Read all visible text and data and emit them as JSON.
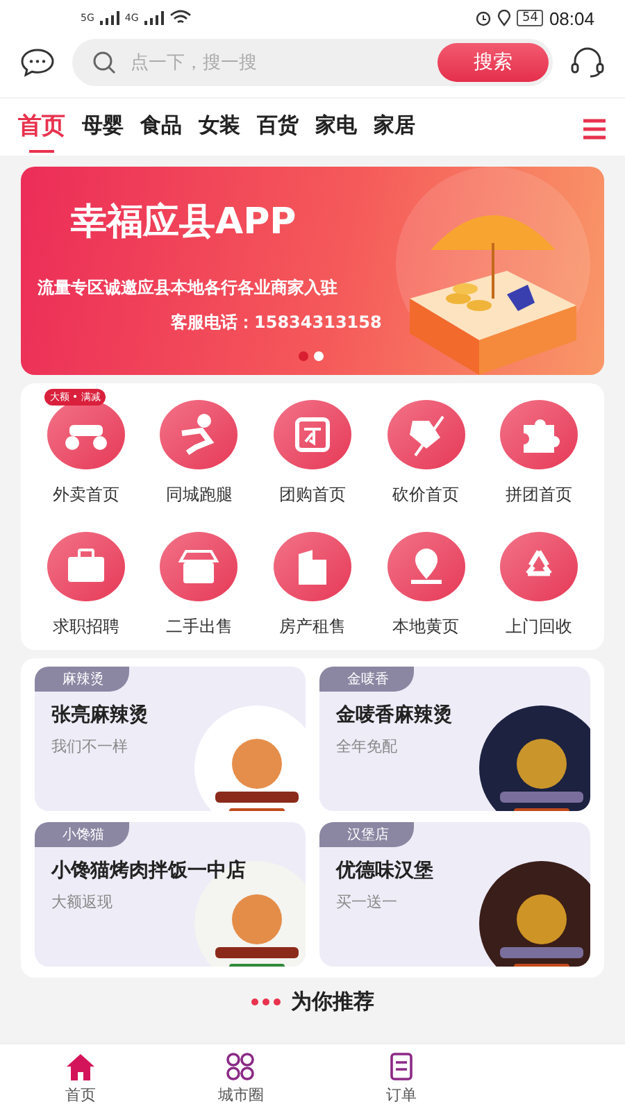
{
  "status_bar": {
    "network_1": "5G",
    "network_2": "4G",
    "battery": "54",
    "time": "08:04"
  },
  "search": {
    "placeholder": "点一下，搜一搜",
    "button": "搜索"
  },
  "tabs": [
    {
      "label": "首页",
      "selected": true
    },
    {
      "label": "母婴",
      "selected": false
    },
    {
      "label": "食品",
      "selected": false
    },
    {
      "label": "女装",
      "selected": false
    },
    {
      "label": "百货",
      "selected": false
    },
    {
      "label": "家电",
      "selected": false
    },
    {
      "label": "家居",
      "selected": false
    }
  ],
  "banner": {
    "title": "幸福应县APP",
    "subtitle": "流量专区诚邀应县本地各行各业商家入驻",
    "phone": "客服电话：15834313158",
    "dots": [
      {
        "selected": true
      },
      {
        "selected": false
      }
    ]
  },
  "services": [
    {
      "label": "外卖首页",
      "badge": "大额 • 满减"
    },
    {
      "label": "同城跑腿"
    },
    {
      "label": "团购首页"
    },
    {
      "label": "砍价首页"
    },
    {
      "label": "拼团首页"
    },
    {
      "label": "求职招聘"
    },
    {
      "label": "二手出售"
    },
    {
      "label": "房产租售"
    },
    {
      "label": "本地黄页"
    },
    {
      "label": "上门回收"
    }
  ],
  "stores": [
    {
      "tag": "麻辣烫",
      "name": "张亮麻辣烫",
      "slogan": "我们不一样"
    },
    {
      "tag": "金唛香",
      "name": "金唛香麻辣烫",
      "slogan": "全年免配"
    },
    {
      "tag": "小馋猫",
      "name": "小馋猫烤肉拌饭一中店",
      "slogan": "大额返现"
    },
    {
      "tag": "汉堡店",
      "name": "优德味汉堡",
      "slogan": "买一送一"
    }
  ],
  "section_title": "为你推荐",
  "bottom_nav": [
    {
      "label": "首页",
      "selected": true
    },
    {
      "label": "城市圈",
      "selected": false
    },
    {
      "label": "订单",
      "selected": false
    }
  ]
}
